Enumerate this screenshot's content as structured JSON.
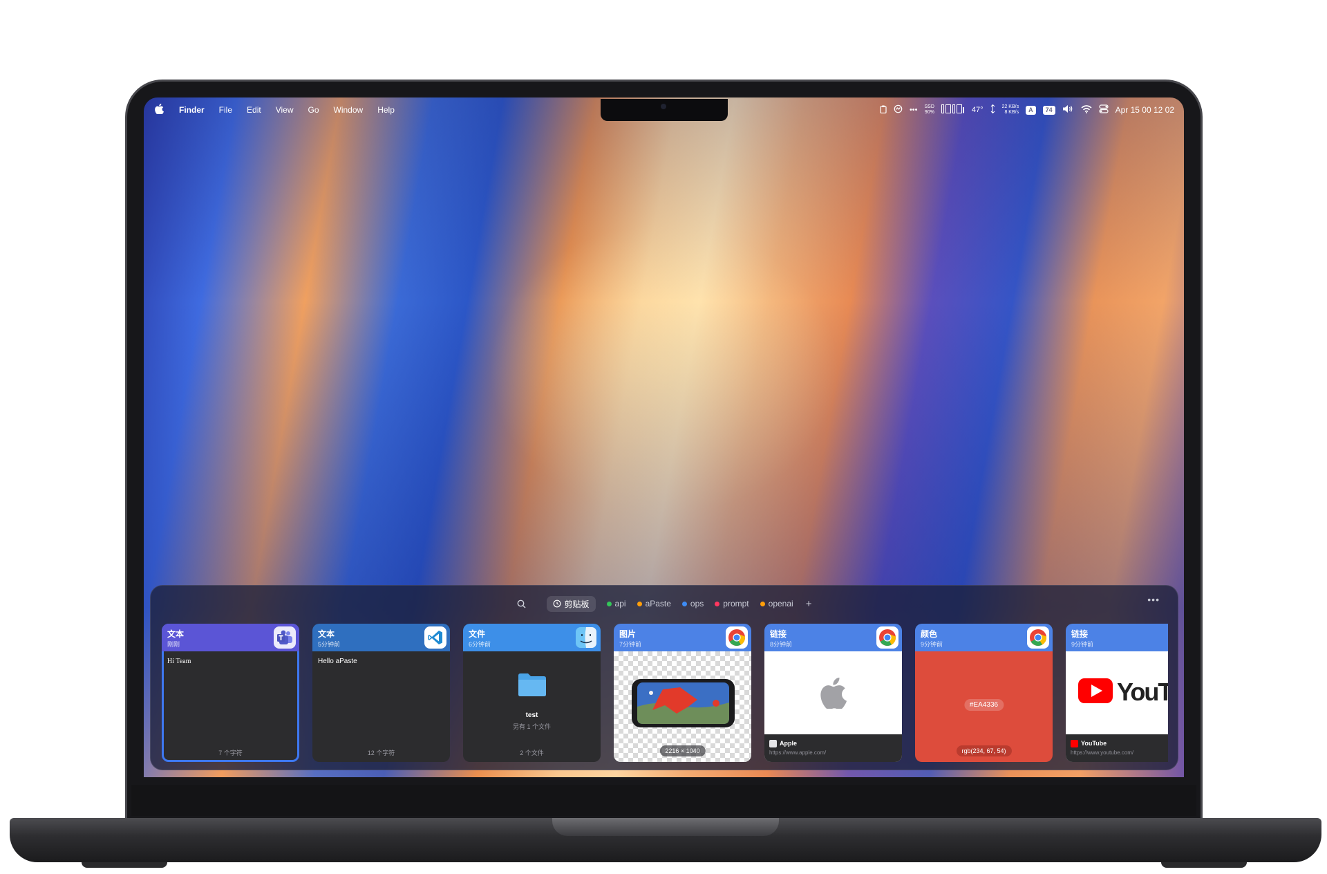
{
  "menubar": {
    "app_name": "Finder",
    "menus": [
      "File",
      "Edit",
      "View",
      "Go",
      "Window",
      "Help"
    ],
    "status": {
      "disk_label": "SSD",
      "disk_value": "90%",
      "temperature": "47°",
      "net_up": "22 KB/s",
      "net_down": "8 KB/s",
      "input_source": "A",
      "battery": "74",
      "clock": "Apr 15  00 12 02"
    }
  },
  "clipboard": {
    "tabs": [
      {
        "label": "剪贴板",
        "active": true
      },
      {
        "label": "api",
        "color": "#34c759"
      },
      {
        "label": "aPaste",
        "color": "#ff9f0a"
      },
      {
        "label": "ops",
        "color": "#3e8cf5"
      },
      {
        "label": "prompt",
        "color": "#ff375f"
      },
      {
        "label": "openai",
        "color": "#ff9f0a"
      }
    ],
    "cards": [
      {
        "type": "文本",
        "time": "刚刚",
        "content": "Hi Team",
        "footer": "7 个字符",
        "head_color": "#5b55d6",
        "app": "teams-icon"
      },
      {
        "type": "文本",
        "time": "5分钟前",
        "content": "Hello aPaste",
        "footer": "12 个字符",
        "head_color": "#2f6fbf",
        "app": "vscode-icon"
      },
      {
        "type": "文件",
        "time": "6分钟前",
        "file_name": "test",
        "file_more": "另有 1 个文件",
        "footer": "2 个文件",
        "head_color": "#3d8fe8",
        "app": "finder-icon"
      },
      {
        "type": "图片",
        "time": "7分钟前",
        "dimensions": "2216 × 1040",
        "head_color": "#4c82e6",
        "app": "chrome-icon"
      },
      {
        "type": "链接",
        "time": "8分钟前",
        "link_title": "Apple",
        "link_url": "https://www.apple.com/",
        "head_color": "#4c82e6",
        "app": "chrome-icon"
      },
      {
        "type": "颜色",
        "time": "9分钟前",
        "hex": "#EA4336",
        "rgb": "rgb(234, 67, 54)",
        "head_color": "#4c82e6",
        "swatch": "#EA4336",
        "app": "chrome-icon"
      },
      {
        "type": "链接",
        "time": "9分钟前",
        "link_title": "YouTube",
        "link_url": "https://www.youtube.com/",
        "preview_text": "YouTub",
        "head_color": "#4c82e6",
        "app": "chrome-icon"
      }
    ]
  }
}
